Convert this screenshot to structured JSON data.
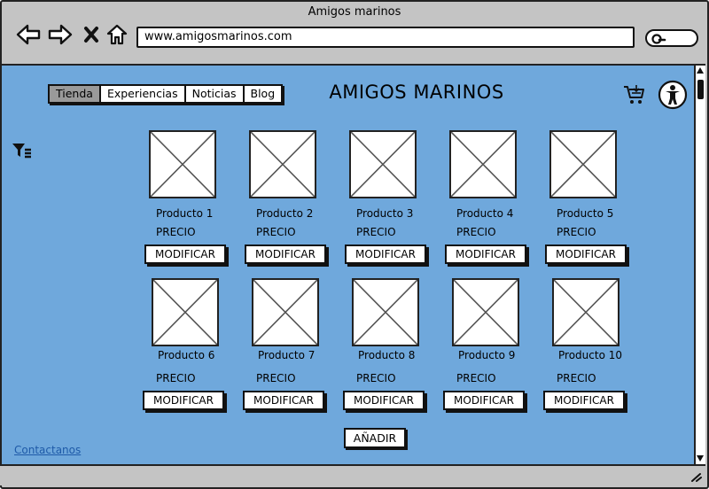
{
  "window": {
    "title": "Amigos marinos"
  },
  "address_bar": {
    "url": "www.amigosmarinos.com"
  },
  "nav": {
    "tabs": [
      {
        "label": "Tienda",
        "active": true
      },
      {
        "label": "Experiencias",
        "active": false
      },
      {
        "label": "Noticias",
        "active": false
      },
      {
        "label": "Blog",
        "active": false
      }
    ]
  },
  "header": {
    "title": "AMIGOS MARINOS"
  },
  "products": [
    {
      "name": "Producto 1",
      "price_label": "PRECIO",
      "button": "MODIFICAR"
    },
    {
      "name": "Producto 2",
      "price_label": "PRECIO",
      "button": "MODIFICAR"
    },
    {
      "name": "Producto 3",
      "price_label": "PRECIO",
      "button": "MODIFICAR"
    },
    {
      "name": "Producto 4",
      "price_label": "PRECIO",
      "button": "MODIFICAR"
    },
    {
      "name": "Producto 5",
      "price_label": "PRECIO",
      "button": "MODIFICAR"
    },
    {
      "name": "Producto 6",
      "price_label": "PRECIO",
      "button": "MODIFICAR"
    },
    {
      "name": "Producto 7",
      "price_label": "PRECIO",
      "button": "MODIFICAR"
    },
    {
      "name": "Producto 8",
      "price_label": "PRECIO",
      "button": "MODIFICAR"
    },
    {
      "name": "Producto 9",
      "price_label": "PRECIO",
      "button": "MODIFICAR"
    },
    {
      "name": "Producto 10",
      "price_label": "PRECIO",
      "button": "MODIFICAR"
    }
  ],
  "actions": {
    "add_label": "AÑADIR"
  },
  "footer": {
    "contact_link": "Contactanos"
  },
  "icons": [
    "back-icon",
    "forward-icon",
    "close-icon",
    "home-icon",
    "search-icon",
    "cart-icon",
    "accessibility-icon",
    "filter-icon"
  ],
  "colors": {
    "page_background": "#6fa8dc",
    "chrome": "#c4c4c4",
    "active_tab": "#9a9a9a",
    "link": "#1e5aa8"
  }
}
